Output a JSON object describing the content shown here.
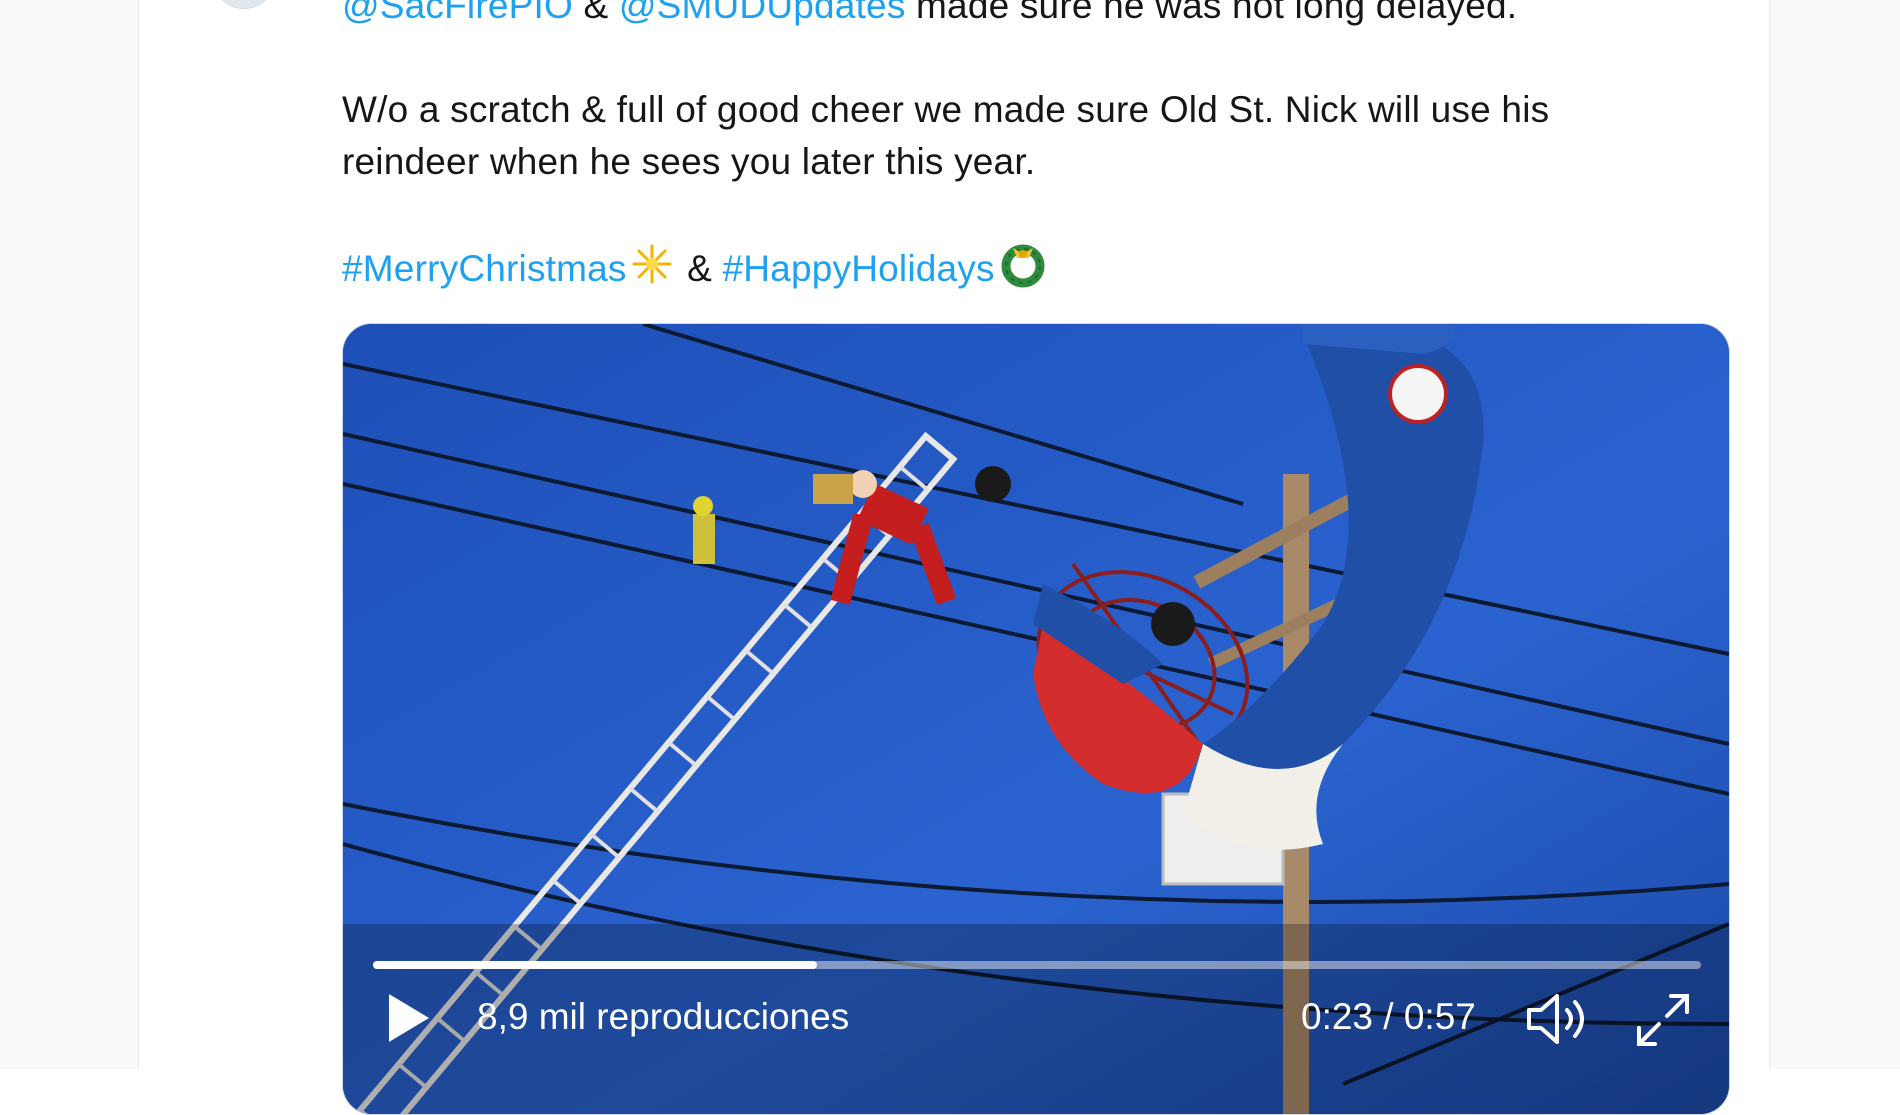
{
  "tweet": {
    "line1": {
      "mention1": "@SacFirePIO",
      "amp": " & ",
      "mention2": "@SMUDUpdates",
      "rest": " made sure he was not long delayed."
    },
    "paragraph2_line1": "W/o a scratch & full of good cheer we made sure Old St. Nick will use his",
    "paragraph2_line2": "reindeer when he sees you later this year.",
    "hashtags": {
      "tag1": "#MerryChristmas",
      "amp": " & ",
      "tag2": "#HappyHolidays"
    },
    "emoji": {
      "sparkle": "sparkle-emoji",
      "wreath": "wreath-emoji"
    }
  },
  "video": {
    "views": "8,9 mil reproducciones",
    "time_current": "0:23",
    "time_separator": " / ",
    "time_total": "0:57",
    "progress_fraction": 0.334
  },
  "colors": {
    "link": "#1da1f2",
    "text": "#14171a",
    "sky": "#1f56c4"
  },
  "icons": [
    "play-icon",
    "volume-icon",
    "fullscreen-icon"
  ]
}
